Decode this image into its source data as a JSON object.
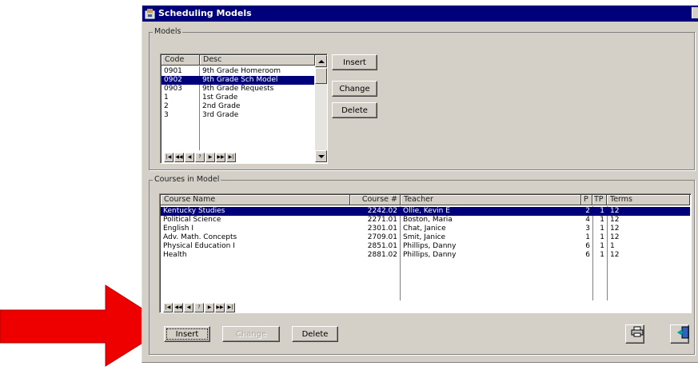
{
  "window": {
    "title": "Scheduling Models"
  },
  "models": {
    "group_label": "Models",
    "columns": [
      "Code",
      "Desc"
    ],
    "rows": [
      {
        "code": "0901",
        "desc": "9th Grade Homeroom",
        "selected": false
      },
      {
        "code": "0902",
        "desc": "9th Grade Sch Model",
        "selected": true
      },
      {
        "code": "0903",
        "desc": "9th Grade Requests",
        "selected": false
      },
      {
        "code": "1",
        "desc": "1st Grade",
        "selected": false
      },
      {
        "code": "2",
        "desc": "2nd Grade",
        "selected": false
      },
      {
        "code": "3",
        "desc": "3rd Grade",
        "selected": false
      }
    ],
    "nav": [
      "|◀",
      "◀◀",
      "◀",
      "?",
      "▶",
      "▶▶",
      "▶|"
    ],
    "buttons": {
      "insert": "Insert",
      "change": "Change",
      "delete": "Delete"
    }
  },
  "courses": {
    "group_label": "Courses in Model",
    "columns": [
      "Course Name",
      "Course #",
      "Teacher",
      "P",
      "TP",
      "Terms"
    ],
    "rows": [
      {
        "name": "Kentucky Studies",
        "num": "2242.02",
        "teacher": "Ollie, Kevin E",
        "p": "2",
        "tp": "1",
        "terms": "12",
        "selected": true
      },
      {
        "name": "Political Science",
        "num": "2271.01",
        "teacher": "Boston, Maria",
        "p": "4",
        "tp": "1",
        "terms": "12",
        "selected": false
      },
      {
        "name": "English I",
        "num": "2301.01",
        "teacher": "Chat, Janice",
        "p": "3",
        "tp": "1",
        "terms": "12",
        "selected": false
      },
      {
        "name": "Adv. Math. Concepts",
        "num": "2709.01",
        "teacher": "Smit, Janice",
        "p": "1",
        "tp": "1",
        "terms": "12",
        "selected": false
      },
      {
        "name": "Physical Education I",
        "num": "2851.01",
        "teacher": "Phillips, Danny",
        "p": "6",
        "tp": "1",
        "terms": "1",
        "selected": false
      },
      {
        "name": "Health",
        "num": "2881.02",
        "teacher": "Phillips, Danny",
        "p": "6",
        "tp": "1",
        "terms": "12",
        "selected": false
      }
    ],
    "nav": [
      "|◀",
      "◀◀",
      "◀",
      "?",
      "▶",
      "▶▶",
      "▶|"
    ],
    "buttons": {
      "insert": "Insert",
      "change": "Change",
      "delete": "Delete"
    }
  },
  "colors": {
    "selection": "#00007a",
    "arrow": "#ee0000",
    "face": "#d4d0c8"
  },
  "icons": {
    "print": "printer-icon",
    "exit": "exit-door-icon",
    "app": "scheduling-app-icon"
  }
}
